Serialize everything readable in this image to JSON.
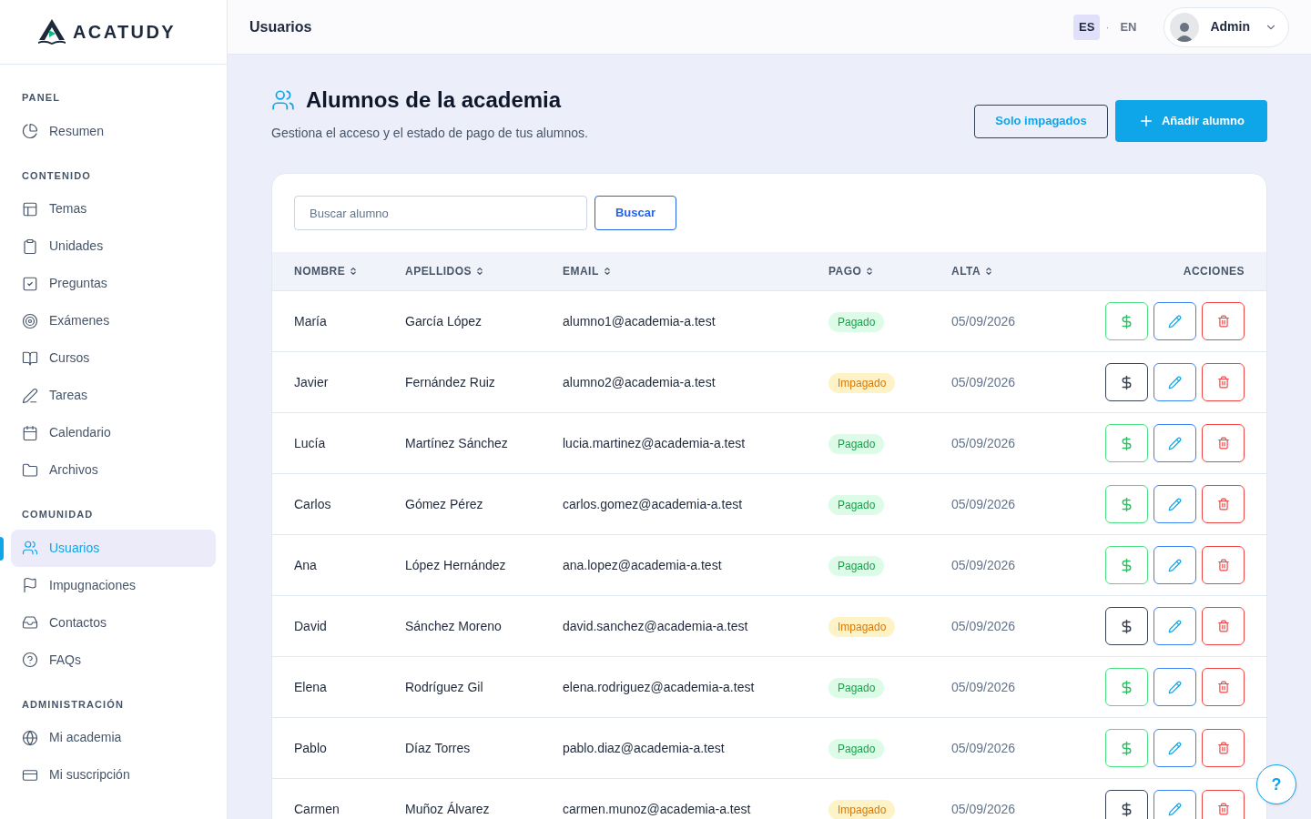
{
  "brand": {
    "name": "ACATUDY"
  },
  "sidebar": {
    "sections": [
      {
        "title": "PANEL",
        "items": [
          {
            "label": "Resumen",
            "selected": false
          }
        ]
      },
      {
        "title": "CONTENIDO",
        "items": [
          {
            "label": "Temas",
            "selected": false
          },
          {
            "label": "Unidades",
            "selected": false
          },
          {
            "label": "Preguntas",
            "selected": false
          },
          {
            "label": "Exámenes",
            "selected": false
          },
          {
            "label": "Cursos",
            "selected": false
          },
          {
            "label": "Tareas",
            "selected": false
          },
          {
            "label": "Calendario",
            "selected": false
          },
          {
            "label": "Archivos",
            "selected": false
          }
        ]
      },
      {
        "title": "COMUNIDAD",
        "items": [
          {
            "label": "Usuarios",
            "selected": true
          },
          {
            "label": "Impugnaciones",
            "selected": false
          },
          {
            "label": "Contactos",
            "selected": false
          },
          {
            "label": "FAQs",
            "selected": false
          }
        ]
      },
      {
        "title": "ADMINISTRACIÓN",
        "items": [
          {
            "label": "Mi academia",
            "selected": false
          },
          {
            "label": "Mi suscripción",
            "selected": false
          }
        ]
      }
    ]
  },
  "header": {
    "title": "Usuarios",
    "languages": [
      {
        "label": "ES",
        "selected": true
      },
      {
        "label": "EN",
        "selected": false
      }
    ],
    "separator": "·",
    "user": "Admin"
  },
  "page": {
    "title": "Alumnos de la academia",
    "subtitle": "Gestiona el acceso y el estado de pago de tus alumnos.",
    "filter_button": "Solo impagados",
    "add_button": "Añadir alumno"
  },
  "search": {
    "placeholder": "Buscar alumno",
    "button": "Buscar"
  },
  "table": {
    "columns": [
      {
        "label": "NOMBRE",
        "sortable": true
      },
      {
        "label": "APELLIDOS",
        "sortable": true
      },
      {
        "label": "EMAIL",
        "sortable": true
      },
      {
        "label": "PAGO",
        "sortable": true
      },
      {
        "label": "ALTA",
        "sortable": true
      },
      {
        "label": "ACCIONES",
        "sortable": false
      }
    ],
    "rows": [
      {
        "nombre": "María",
        "apellidos": "García López",
        "email": "alumno1@academia-a.test",
        "pago": {
          "label": "Pagado",
          "kind": "paid"
        },
        "alta": "05/09/2026"
      },
      {
        "nombre": "Javier",
        "apellidos": "Fernández Ruiz",
        "email": "alumno2@academia-a.test",
        "pago": {
          "label": "Impagado",
          "kind": "unpaid"
        },
        "alta": "05/09/2026"
      },
      {
        "nombre": "Lucía",
        "apellidos": "Martínez Sánchez",
        "email": "lucia.martinez@academia-a.test",
        "pago": {
          "label": "Pagado",
          "kind": "paid"
        },
        "alta": "05/09/2026"
      },
      {
        "nombre": "Carlos",
        "apellidos": "Gómez Pérez",
        "email": "carlos.gomez@academia-a.test",
        "pago": {
          "label": "Pagado",
          "kind": "paid"
        },
        "alta": "05/09/2026"
      },
      {
        "nombre": "Ana",
        "apellidos": "López Hernández",
        "email": "ana.lopez@academia-a.test",
        "pago": {
          "label": "Pagado",
          "kind": "paid"
        },
        "alta": "05/09/2026"
      },
      {
        "nombre": "David",
        "apellidos": "Sánchez Moreno",
        "email": "david.sanchez@academia-a.test",
        "pago": {
          "label": "Impagado",
          "kind": "unpaid"
        },
        "alta": "05/09/2026"
      },
      {
        "nombre": "Elena",
        "apellidos": "Rodríguez Gil",
        "email": "elena.rodriguez@academia-a.test",
        "pago": {
          "label": "Pagado",
          "kind": "paid"
        },
        "alta": "05/09/2026"
      },
      {
        "nombre": "Pablo",
        "apellidos": "Díaz Torres",
        "email": "pablo.diaz@academia-a.test",
        "pago": {
          "label": "Pagado",
          "kind": "paid"
        },
        "alta": "05/09/2026"
      },
      {
        "nombre": "Carmen",
        "apellidos": "Muñoz Álvarez",
        "email": "carmen.munoz@academia-a.test",
        "pago": {
          "label": "Impagado",
          "kind": "unpaid"
        },
        "alta": "05/09/2026"
      }
    ]
  },
  "help_button": "?"
}
